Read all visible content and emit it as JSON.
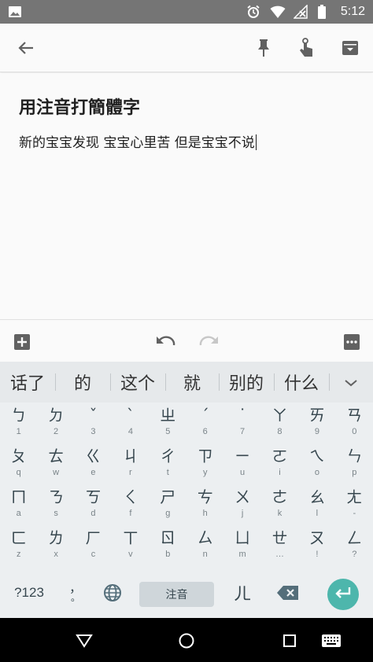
{
  "status_bar": {
    "time": "5:12",
    "icons": [
      "image-icon",
      "alarm-icon",
      "wifi-icon",
      "no-signal-icon",
      "battery-icon"
    ]
  },
  "toolbar": {
    "icons": [
      "back-arrow-icon",
      "pin-icon",
      "reminder-hand-icon",
      "archive-icon"
    ]
  },
  "note": {
    "title": "用注音打簡體字",
    "body": "新的宝宝发现 宝宝心里苦 但是宝宝不说"
  },
  "edit_bar": {
    "icons": [
      "add-box-icon",
      "undo-icon",
      "redo-icon",
      "more-options-icon"
    ]
  },
  "candidates": [
    "话了",
    "的",
    "这个",
    "就",
    "别的",
    "什么"
  ],
  "keyboard": {
    "rows": [
      [
        {
          "main": "ㄅ",
          "hint": "1"
        },
        {
          "main": "ㄉ",
          "hint": "2"
        },
        {
          "main": "ˇ",
          "hint": "3"
        },
        {
          "main": "ˋ",
          "hint": "4"
        },
        {
          "main": "ㄓ",
          "hint": "5"
        },
        {
          "main": "ˊ",
          "hint": "6"
        },
        {
          "main": "˙",
          "hint": "7"
        },
        {
          "main": "ㄚ",
          "hint": "8"
        },
        {
          "main": "ㄞ",
          "hint": "9"
        },
        {
          "main": "ㄢ",
          "hint": "0"
        }
      ],
      [
        {
          "main": "ㄆ",
          "hint": "q"
        },
        {
          "main": "ㄊ",
          "hint": "w"
        },
        {
          "main": "ㄍ",
          "hint": "e"
        },
        {
          "main": "ㄐ",
          "hint": "r"
        },
        {
          "main": "ㄔ",
          "hint": "t"
        },
        {
          "main": "ㄗ",
          "hint": "y"
        },
        {
          "main": "ㄧ",
          "hint": "u"
        },
        {
          "main": "ㄛ",
          "hint": "i"
        },
        {
          "main": "ㄟ",
          "hint": "o"
        },
        {
          "main": "ㄣ",
          "hint": "p"
        }
      ],
      [
        {
          "main": "ㄇ",
          "hint": "a"
        },
        {
          "main": "ㄋ",
          "hint": "s"
        },
        {
          "main": "ㄎ",
          "hint": "d"
        },
        {
          "main": "ㄑ",
          "hint": "f"
        },
        {
          "main": "ㄕ",
          "hint": "g"
        },
        {
          "main": "ㄘ",
          "hint": "h"
        },
        {
          "main": "ㄨ",
          "hint": "j"
        },
        {
          "main": "ㄜ",
          "hint": "k"
        },
        {
          "main": "ㄠ",
          "hint": "l"
        },
        {
          "main": "ㄤ",
          "hint": "-"
        }
      ],
      [
        {
          "main": "ㄈ",
          "hint": "z"
        },
        {
          "main": "ㄌ",
          "hint": "x"
        },
        {
          "main": "ㄏ",
          "hint": "c"
        },
        {
          "main": "ㄒ",
          "hint": "v"
        },
        {
          "main": "ㄖ",
          "hint": "b"
        },
        {
          "main": "ㄙ",
          "hint": "n"
        },
        {
          "main": "ㄩ",
          "hint": "m"
        },
        {
          "main": "ㄝ",
          "hint": "…"
        },
        {
          "main": "ㄡ",
          "hint": "!"
        },
        {
          "main": "ㄥ",
          "hint": "?"
        }
      ]
    ],
    "bottom": {
      "symbols_label": "?123",
      "punct_label": "，",
      "punct_sub": "。",
      "space_label": "注音",
      "er_label": "ㄦ"
    }
  },
  "colors": {
    "accent": "#4db6ac",
    "status_bar": "#757575",
    "keyboard_bg": "#eceff1"
  }
}
